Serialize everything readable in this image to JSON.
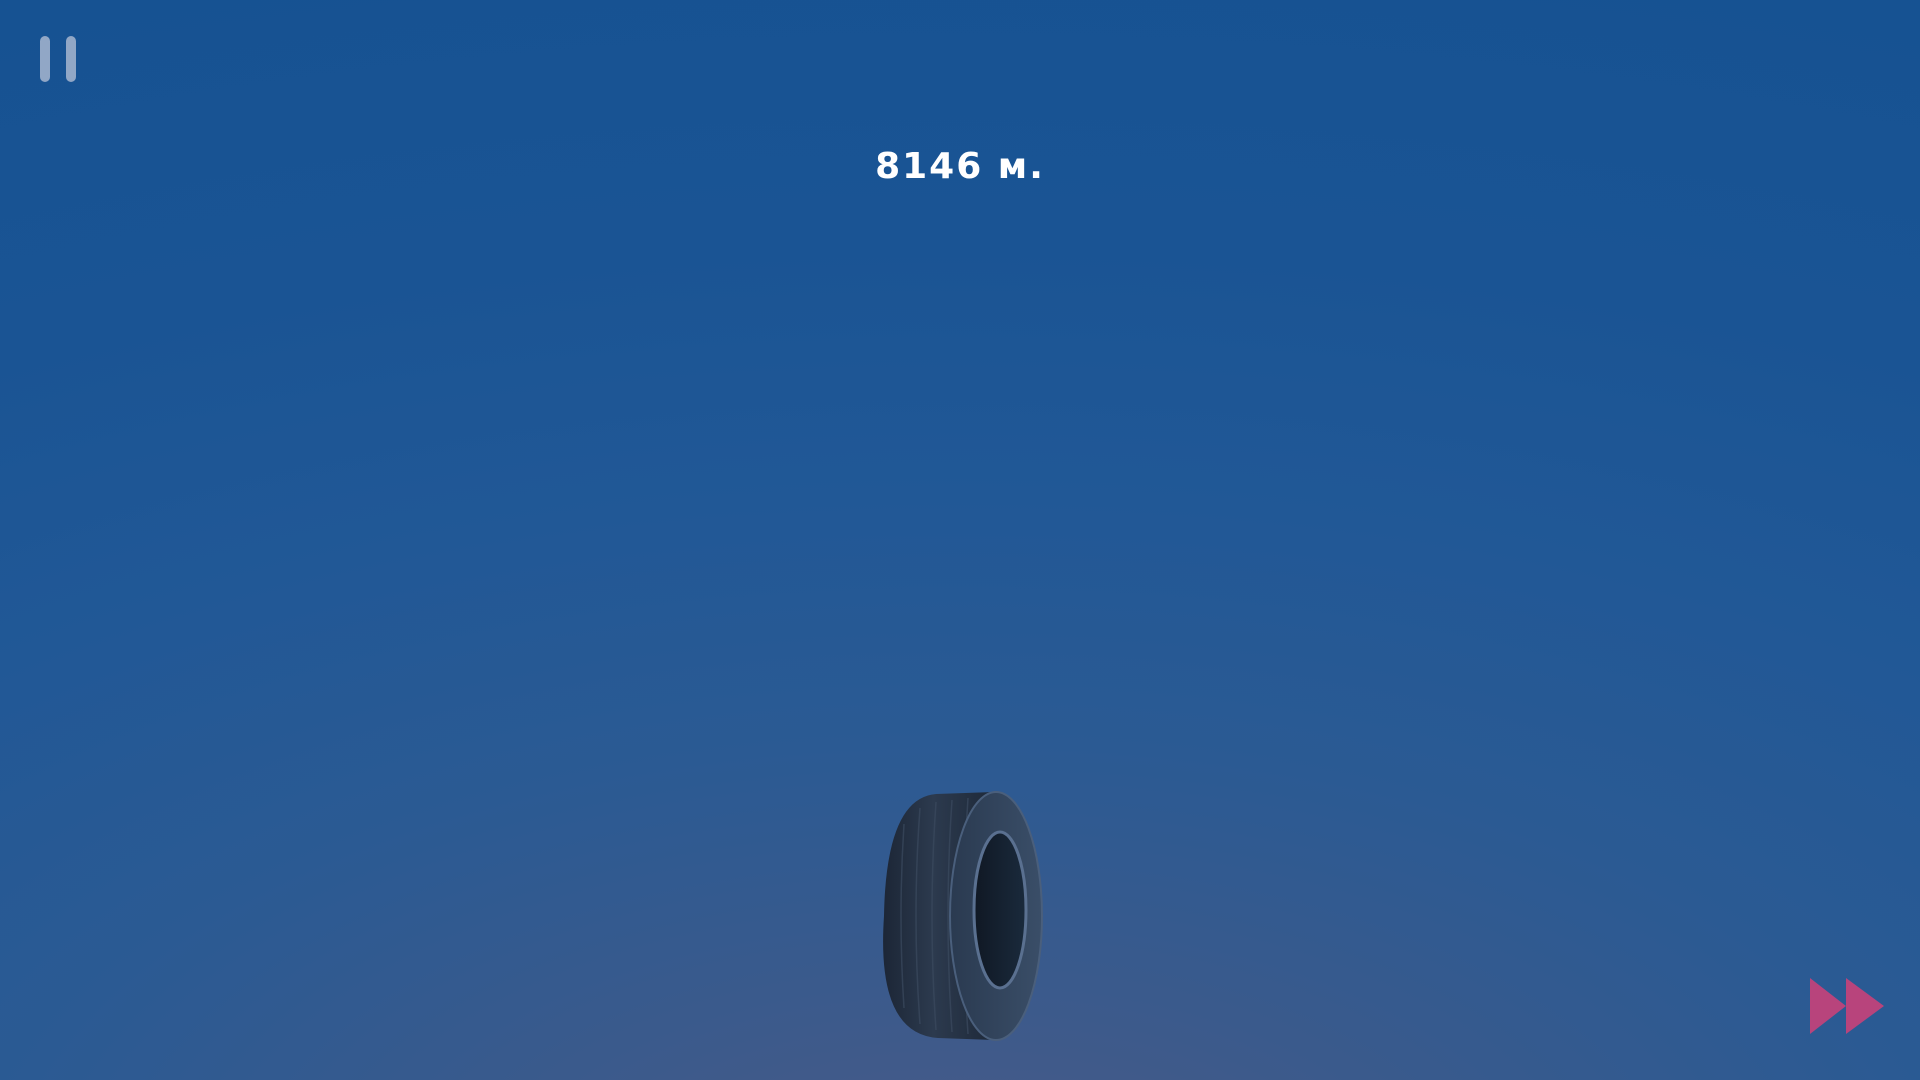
{
  "hud": {
    "distance_label": "8146 м.",
    "pause_icon": "pause-icon",
    "fast_forward_icon": "fast-forward-icon"
  },
  "scene": {
    "object": "tire",
    "colors": {
      "sky_top": "#165292",
      "sky_bottom": "#4b5a86",
      "fast_forward_accent": "#b8447c",
      "pause_icon": "#9fb0cc",
      "distance_text": "#ffffff"
    }
  }
}
